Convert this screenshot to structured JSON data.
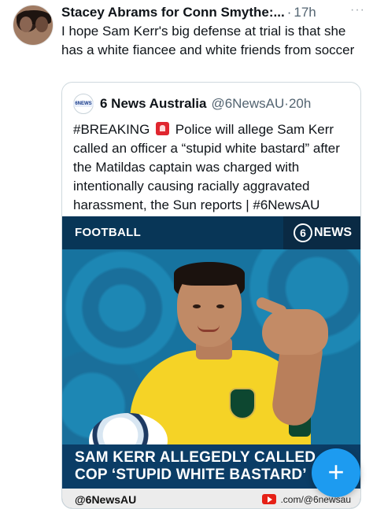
{
  "tweet": {
    "author": "Stacey Abrams for Conn Smythe:...",
    "separator": "·",
    "time": "17h",
    "more": "···",
    "text": "I hope Sam Kerr's big defense at trial is that she has a white fiancee and white friends from soccer"
  },
  "quote": {
    "avatar_text": "6NEWS",
    "name": "6 News Australia",
    "handle": "@6NewsAU",
    "separator": "·",
    "time": "20h",
    "text_before": "#BREAKING",
    "text_after": "Police will allege Sam Kerr called an officer a “stupid white bastard” after the Matildas captain was charged with intentionally causing racially aggravated harassment, the Sun reports | #6NewsAU"
  },
  "media": {
    "category": "FOOTBALL",
    "logo_number": "6",
    "logo_text": "NEWS",
    "headline_line1": "SAM KERR ALLEGEDLY CALLED",
    "headline_line2": "COP ‘STUPID WHITE BASTARD’",
    "footer_handle": "@6NewsAU",
    "footer_link": ".com/@6newsau"
  },
  "fab": {
    "label": "+"
  },
  "colors": {
    "accent": "#1d9bf0",
    "media_bg": "#0b3d66",
    "jersey": "#f5d326"
  },
  "icons": [
    "more-icon",
    "siren-icon",
    "youtube-icon",
    "compose-plus-icon"
  ]
}
